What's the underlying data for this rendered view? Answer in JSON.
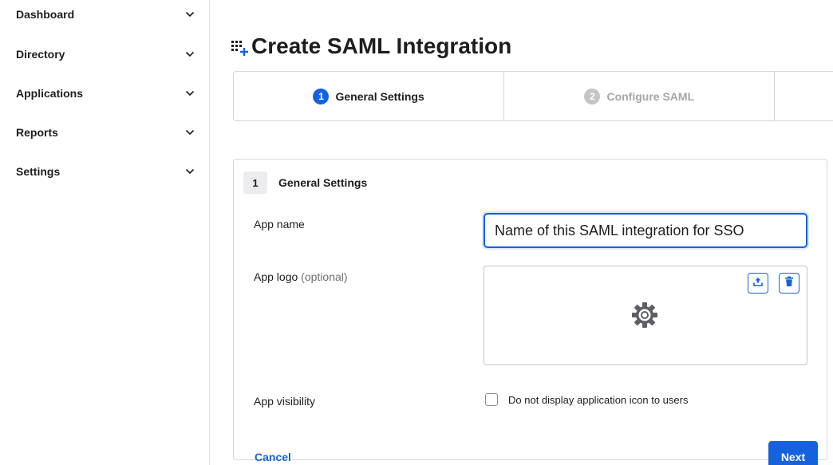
{
  "sidebar": {
    "items": [
      {
        "label": "Dashboard",
        "icon": "chevron-down-icon"
      },
      {
        "label": "Directory",
        "icon": "chevron-down-icon"
      },
      {
        "label": "Applications",
        "icon": "chevron-down-icon"
      },
      {
        "label": "Reports",
        "icon": "chevron-down-icon"
      },
      {
        "label": "Settings",
        "icon": "chevron-down-icon"
      }
    ]
  },
  "header": {
    "icon": "add-app-grid-icon",
    "title": "Create SAML Integration"
  },
  "stepper": {
    "steps": [
      {
        "number": "1",
        "label": "General Settings",
        "state": "active"
      },
      {
        "number": "2",
        "label": "Configure SAML",
        "state": "inactive"
      }
    ]
  },
  "form": {
    "section_number": "1",
    "section_title": "General Settings",
    "app_name_label": "App name",
    "app_name_value": "Name of this SAML integration for SSO",
    "app_logo_label": "App logo",
    "app_logo_optional": "(optional)",
    "logo_upload_icon": "upload-icon",
    "logo_delete_icon": "trash-icon",
    "logo_placeholder_icon": "gear-icon",
    "app_visibility_label": "App visibility",
    "visibility_checkbox_label": "Do not display application icon to users",
    "visibility_checked": false,
    "cancel_label": "Cancel",
    "next_label": "Next"
  },
  "colors": {
    "accent": "#1662dd",
    "inactive_step": "#c4c4c9",
    "border": "#d7d7dc"
  }
}
